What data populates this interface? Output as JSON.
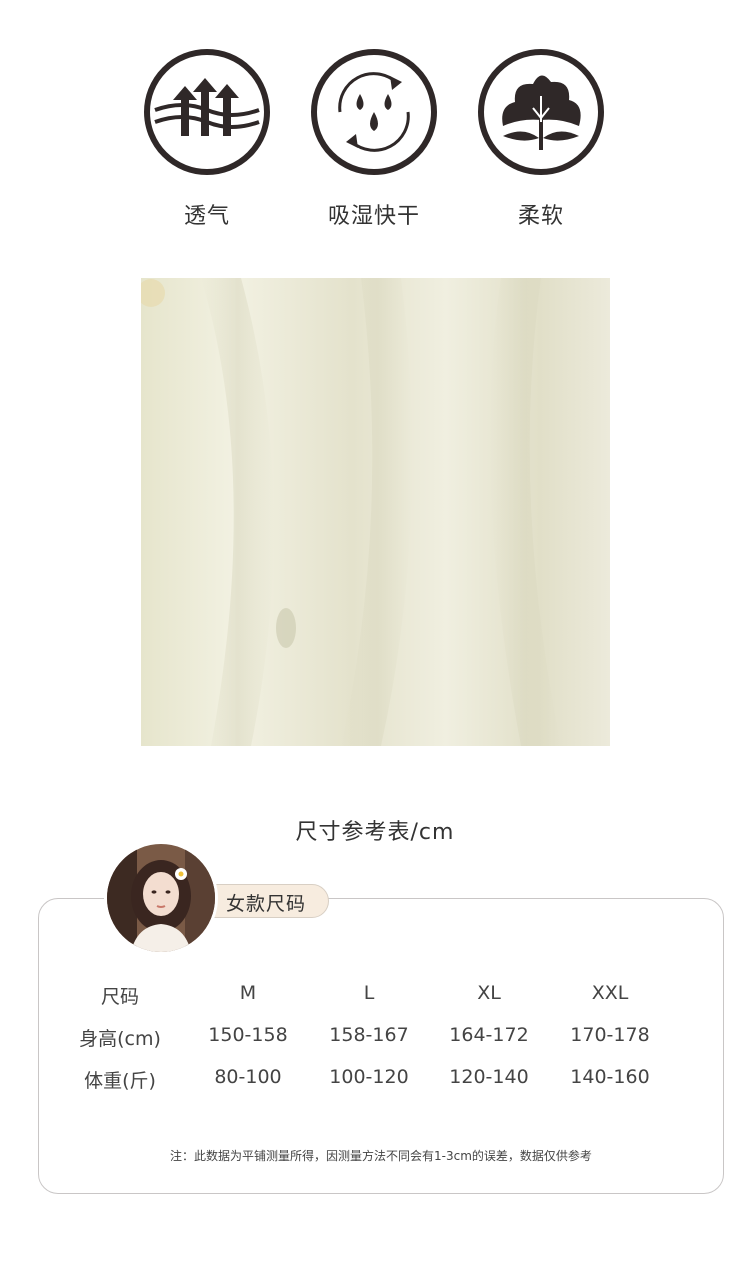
{
  "features": [
    {
      "icon": "breathable-arrows-icon",
      "label": "透气"
    },
    {
      "icon": "moisture-drops-icon",
      "label": "吸湿快干"
    },
    {
      "icon": "cotton-flower-icon",
      "label": "柔软"
    }
  ],
  "size_chart": {
    "title": "尺寸参考表/cm",
    "tag": "女款尺码",
    "header": [
      "尺码",
      "M",
      "L",
      "XL",
      "XXL"
    ],
    "rows": [
      [
        "身高(cm)",
        "150-158",
        "158-167",
        "164-172",
        "170-178"
      ],
      [
        "体重(斤)",
        "80-100",
        "100-120",
        "120-140",
        "140-160"
      ]
    ],
    "note": "注：此数据为平铺测量所得，因测量方法不同会有1-3cm的误差，数据仅供参考"
  },
  "colors": {
    "icon_dark": "#2f2828",
    "fabric": "#ecebd8",
    "tag_bg": "#f7ecdf",
    "border": "#c9c6c6"
  }
}
